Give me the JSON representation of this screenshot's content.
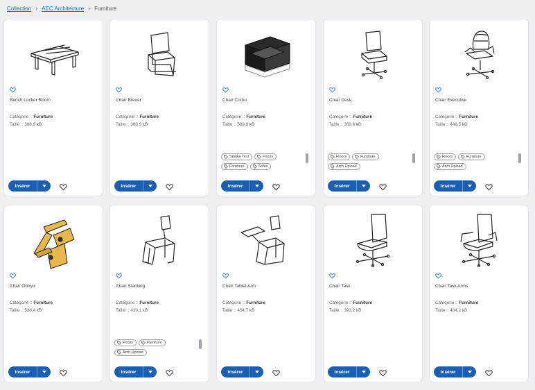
{
  "breadcrumb": {
    "items": [
      "Collection",
      "AEC Architecture"
    ],
    "current": "Furniture"
  },
  "labels": {
    "category_prefix": "Catégorie :: ",
    "size_prefix": "Taille :: ",
    "insert": "Insérer"
  },
  "colors": {
    "primary": "#1a5fb4",
    "link": "#1a66c4",
    "background": "#eef0f3",
    "chair_accent": "#e8b84d"
  },
  "cards": [
    {
      "name": "Bench Locker Room",
      "category": "Furniture",
      "size": "368,6 kB",
      "icon": "bench-icon",
      "tags": []
    },
    {
      "name": "Chair Breuer",
      "category": "Furniture",
      "size": "380,9 kB",
      "icon": "cantilever-chair-icon",
      "tags": []
    },
    {
      "name": "Chair Corbu",
      "category": "Furniture",
      "size": "589,8 kB",
      "icon": "armchair-icon",
      "tags": [
        "Smoke Test",
        "Floors",
        "Furniture",
        "Sofas"
      ]
    },
    {
      "name": "Chair Desk",
      "category": "Furniture",
      "size": "368,6 kB",
      "icon": "desk-chair-icon",
      "tags": [
        "Floors",
        "Furniture",
        "Arch Upload"
      ]
    },
    {
      "name": "Chair Executive",
      "category": "Furniture",
      "size": "446,5 kB",
      "icon": "executive-chair-icon",
      "tags": [
        "Floors",
        "Furniture",
        "Arch Upload"
      ]
    },
    {
      "name": "Chair Oonyu",
      "category": "Furniture",
      "size": "528,4 kB",
      "icon": "wooden-chair-icon",
      "tags": []
    },
    {
      "name": "Chair Stacking",
      "category": "Furniture",
      "size": "430,1 kB",
      "icon": "stacking-chair-icon",
      "tags": [
        "Floors",
        "Furniture",
        "Arch Upload"
      ]
    },
    {
      "name": "Chair Tablet Arm",
      "category": "Furniture",
      "size": "454,7 kB",
      "icon": "tablet-arm-chair-icon",
      "tags": []
    },
    {
      "name": "Chair Task",
      "category": "Furniture",
      "size": "393,2 kB",
      "icon": "task-chair-icon",
      "tags": []
    },
    {
      "name": "Chair Task Arms",
      "category": "Furniture",
      "size": "434,2 kB",
      "icon": "task-chair-arms-icon",
      "tags": []
    }
  ]
}
